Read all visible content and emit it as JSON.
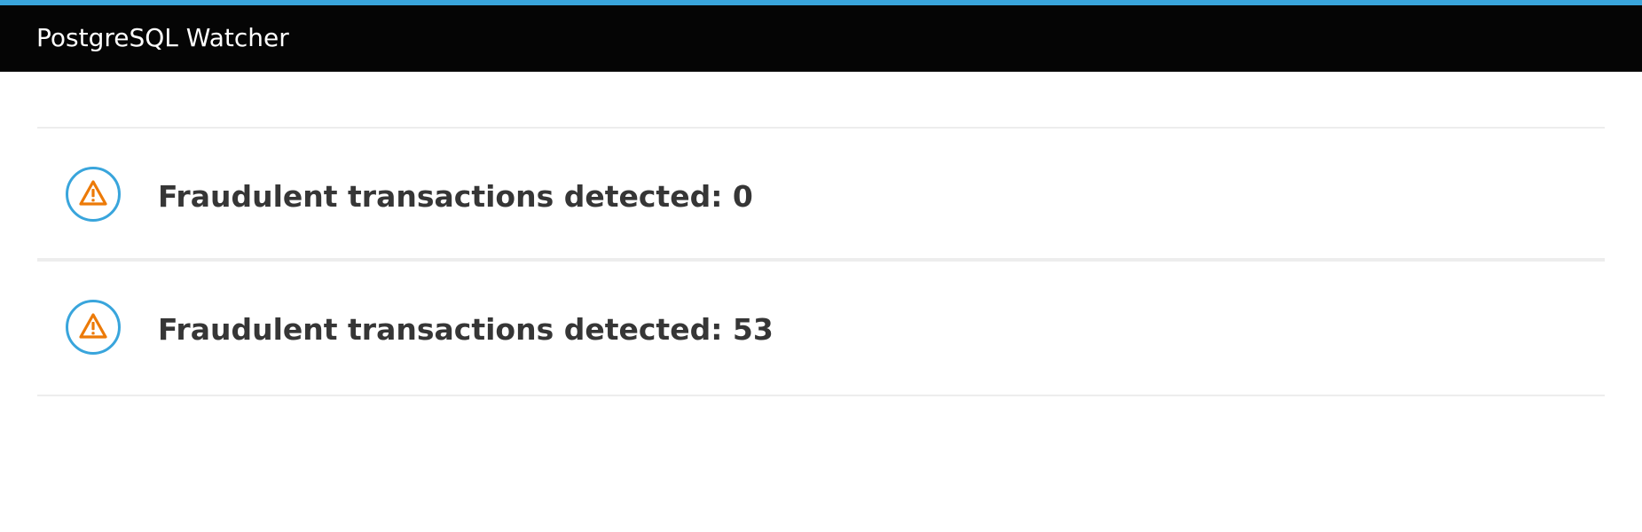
{
  "app": {
    "title": "PostgreSQL Watcher"
  },
  "colors": {
    "accent": "#39a5dc",
    "header_bg": "#050505",
    "warning": "#ec7a08",
    "text": "#363636"
  },
  "alerts": [
    {
      "icon": "warning-triangle-icon",
      "text": "Fraudulent transactions detected: 0"
    },
    {
      "icon": "warning-triangle-icon",
      "text": "Fraudulent transactions detected: 53"
    }
  ]
}
